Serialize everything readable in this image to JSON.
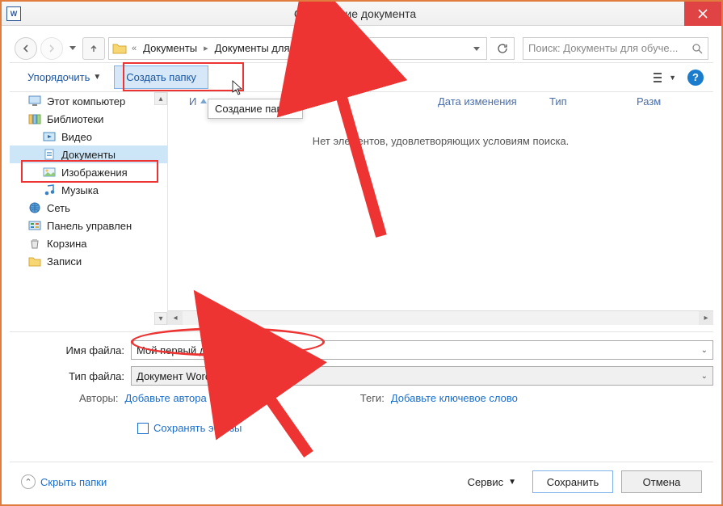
{
  "window": {
    "title": "Сохранение документа"
  },
  "nav": {
    "breadcrumbs": [
      "Документы",
      "Документы для обучения"
    ],
    "search_placeholder": "Поиск: Документы для обуче..."
  },
  "toolbar": {
    "organize": "Упорядочить",
    "new_folder": "Создать папку",
    "tooltip": "Создание папки."
  },
  "list": {
    "columns": {
      "name_short": "И",
      "date": "Дата изменения",
      "type": "Тип",
      "size": "Разм"
    },
    "empty": "Нет элементов, удовлетворяющих условиям поиска."
  },
  "tree": {
    "items": [
      {
        "label": "Этот компьютер",
        "level": 1
      },
      {
        "label": "Библиотеки",
        "level": 1
      },
      {
        "label": "Видео",
        "level": 2
      },
      {
        "label": "Документы",
        "level": 2,
        "selected": true
      },
      {
        "label": "Изображения",
        "level": 2
      },
      {
        "label": "Музыка",
        "level": 2
      },
      {
        "label": "Сеть",
        "level": 1
      },
      {
        "label": "Панель управлен",
        "level": 1
      },
      {
        "label": "Корзина",
        "level": 1
      },
      {
        "label": "Записи",
        "level": 1
      }
    ]
  },
  "form": {
    "filename_label": "Имя файла:",
    "filename_value": "Мой первый документ.docx",
    "filetype_label": "Тип файла:",
    "filetype_value": "Документ Word (*.docx)",
    "authors_label": "Авторы:",
    "authors_link": "Добавьте автора",
    "tags_label": "Теги:",
    "tags_link": "Добавьте ключевое слово",
    "save_thumb": "Сохранять эскизы"
  },
  "footer": {
    "hide_folders": "Скрыть папки",
    "service": "Сервис",
    "save": "Сохранить",
    "cancel": "Отмена"
  }
}
